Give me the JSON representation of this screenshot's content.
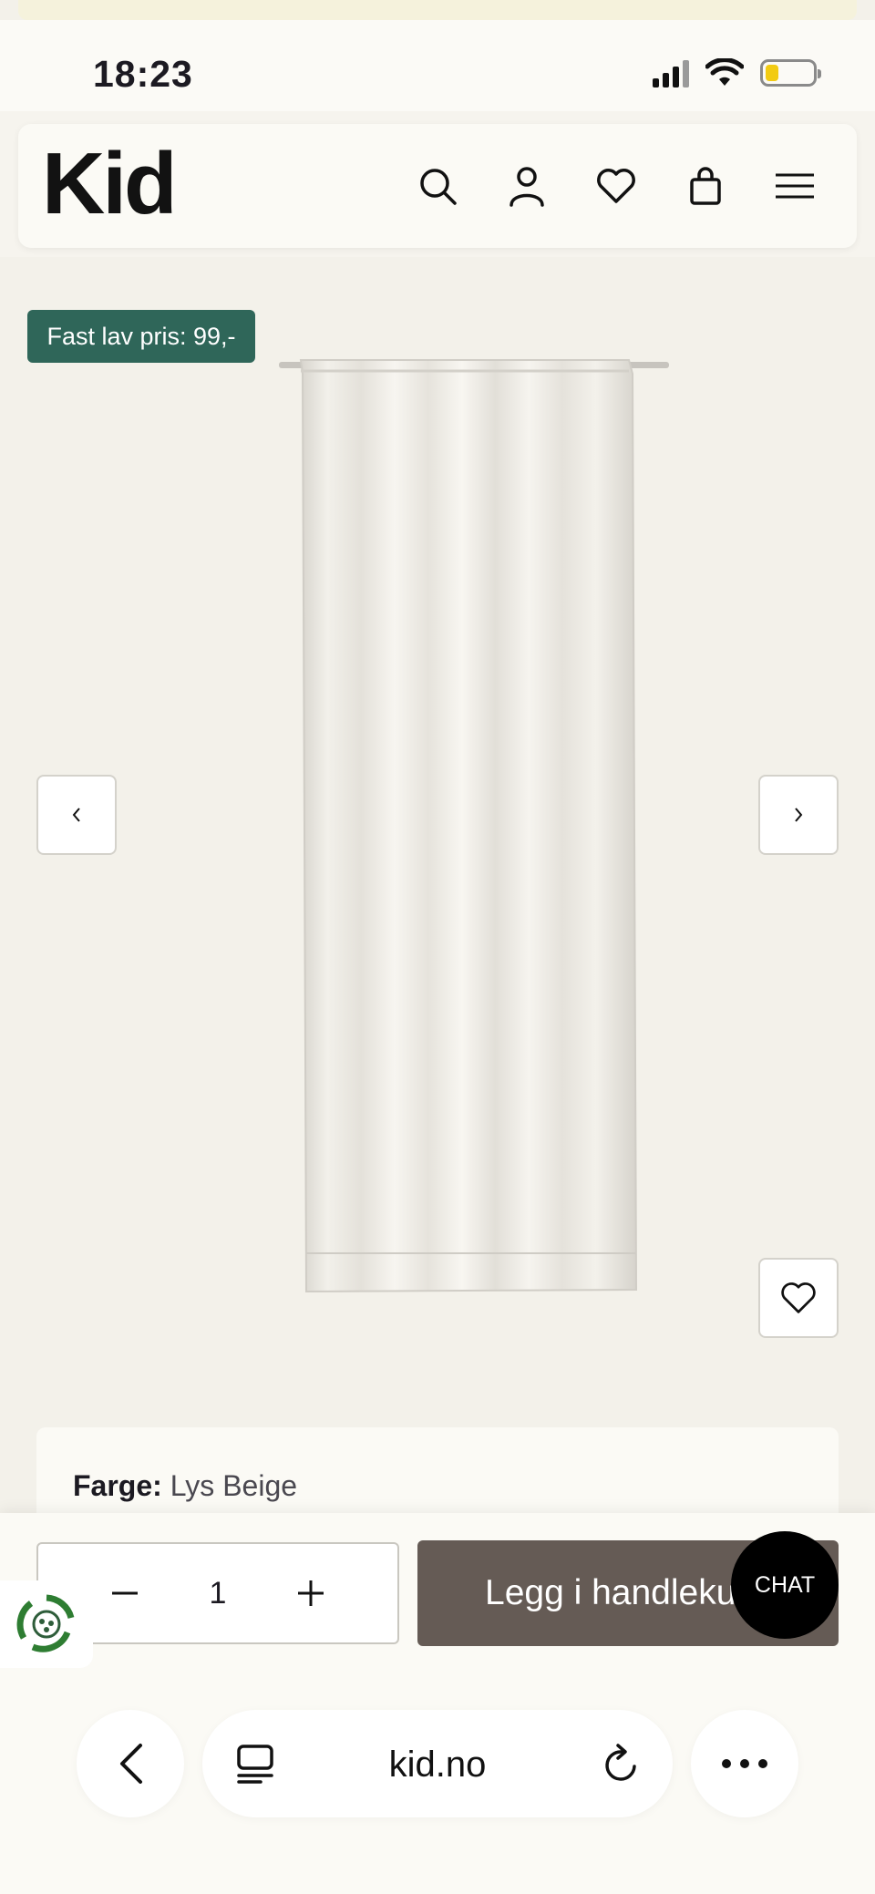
{
  "status_bar": {
    "time": "18:23"
  },
  "header": {
    "logo": "Kid"
  },
  "product": {
    "badge": "Fast lav pris: 99,-",
    "color_label": "Farge:",
    "color_value": "Lys Beige"
  },
  "purchase": {
    "quantity": "1",
    "add_to_cart_label": "Legg i handlekurv",
    "chat_label": "CHAT"
  },
  "browser": {
    "url": "kid.no"
  },
  "colors": {
    "badge_bg": "#2f6659",
    "cart_button_bg": "#655b55",
    "page_bg": "#f3f1ea"
  }
}
